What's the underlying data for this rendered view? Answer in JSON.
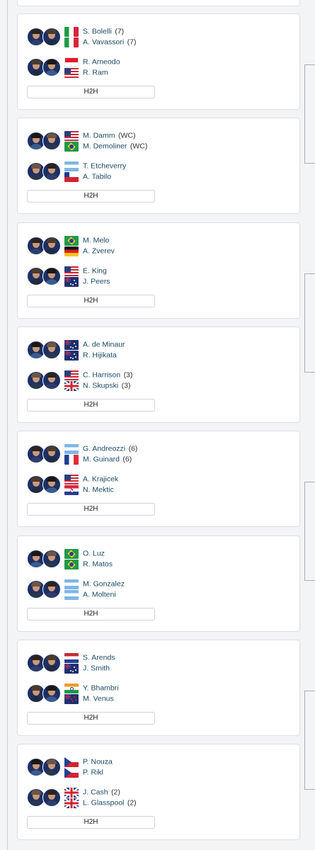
{
  "h2h_label": "H2H",
  "flag_colors": {
    "ita": "#1f9a48",
    "usa": "#2c3e7a",
    "bra": "#1e9a4a"
  },
  "matches": [
    {
      "teams": [
        {
          "players": [
            {
              "name": "S. Bolelli",
              "seed": "(7)",
              "flag": "ita"
            },
            {
              "name": "A. Vavassori",
              "seed": "(7)",
              "flag": "ita"
            }
          ]
        },
        {
          "players": [
            {
              "name": "R. Arneodo",
              "seed": "",
              "flag": "mco"
            },
            {
              "name": "R. Ram",
              "seed": "",
              "flag": "usa"
            }
          ]
        }
      ]
    },
    {
      "teams": [
        {
          "players": [
            {
              "name": "M. Damm",
              "seed": "(WC)",
              "flag": "usa"
            },
            {
              "name": "M. Demoliner",
              "seed": "(WC)",
              "flag": "bra"
            }
          ]
        },
        {
          "players": [
            {
              "name": "T. Etcheverry",
              "seed": "",
              "flag": "arg"
            },
            {
              "name": "A. Tabilo",
              "seed": "",
              "flag": "chi"
            }
          ]
        }
      ]
    },
    {
      "teams": [
        {
          "players": [
            {
              "name": "M. Melo",
              "seed": "",
              "flag": "bra"
            },
            {
              "name": "A. Zverev",
              "seed": "",
              "flag": "ger"
            }
          ]
        },
        {
          "players": [
            {
              "name": "E. King",
              "seed": "",
              "flag": "usa"
            },
            {
              "name": "J. Peers",
              "seed": "",
              "flag": "aus"
            }
          ]
        }
      ]
    },
    {
      "teams": [
        {
          "players": [
            {
              "name": "A. de Minaur",
              "seed": "",
              "flag": "aus"
            },
            {
              "name": "R. Hijikata",
              "seed": "",
              "flag": "aus"
            }
          ]
        },
        {
          "players": [
            {
              "name": "C. Harrison",
              "seed": "(3)",
              "flag": "usa"
            },
            {
              "name": "N. Skupski",
              "seed": "(3)",
              "flag": "gbr"
            }
          ]
        }
      ]
    },
    {
      "teams": [
        {
          "players": [
            {
              "name": "G. Andreozzi",
              "seed": "(6)",
              "flag": "arg"
            },
            {
              "name": "M. Guinard",
              "seed": "(6)",
              "flag": "fra"
            }
          ]
        },
        {
          "players": [
            {
              "name": "A. Krajicek",
              "seed": "",
              "flag": "usa"
            },
            {
              "name": "N. Mektic",
              "seed": "",
              "flag": "cro"
            }
          ]
        }
      ]
    },
    {
      "teams": [
        {
          "players": [
            {
              "name": "O. Luz",
              "seed": "",
              "flag": "bra"
            },
            {
              "name": "R. Matos",
              "seed": "",
              "flag": "bra"
            }
          ]
        },
        {
          "players": [
            {
              "name": "M. Gonzalez",
              "seed": "",
              "flag": "arg"
            },
            {
              "name": "A. Molteni",
              "seed": "",
              "flag": "arg"
            }
          ]
        }
      ]
    },
    {
      "teams": [
        {
          "players": [
            {
              "name": "S. Arends",
              "seed": "",
              "flag": "ned"
            },
            {
              "name": "J. Smith",
              "seed": "",
              "flag": "aus"
            }
          ]
        },
        {
          "players": [
            {
              "name": "Y. Bhambri",
              "seed": "",
              "flag": "ind"
            },
            {
              "name": "M. Venus",
              "seed": "",
              "flag": "nzl"
            }
          ]
        }
      ]
    },
    {
      "teams": [
        {
          "players": [
            {
              "name": "P. Nouza",
              "seed": "",
              "flag": "cze"
            },
            {
              "name": "P. Rikl",
              "seed": "",
              "flag": "cze"
            }
          ]
        },
        {
          "players": [
            {
              "name": "J. Cash",
              "seed": "(2)",
              "flag": "gbr"
            },
            {
              "name": "L. Glasspool",
              "seed": "(2)",
              "flag": "gbr"
            }
          ]
        }
      ]
    }
  ]
}
